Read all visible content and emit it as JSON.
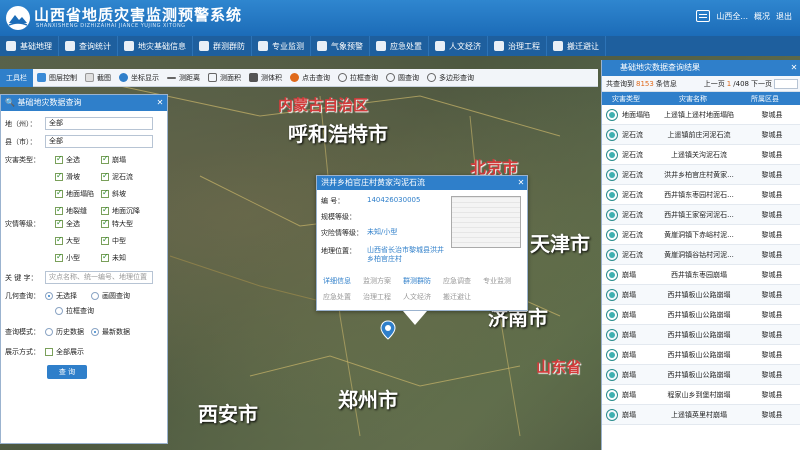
{
  "header": {
    "title": "山西省地质灾害监测预警系统",
    "subtitle": "SHANXISHENG DIZHIZAIHAI JIANCE YUJING XITONG",
    "user": "山西全...",
    "links": [
      "概况",
      "退出"
    ]
  },
  "nav": [
    {
      "label": "基础地理",
      "icon": "globe-icon"
    },
    {
      "label": "查询统计",
      "icon": "chart-icon"
    },
    {
      "label": "地灾基础信息",
      "icon": "document-icon"
    },
    {
      "label": "群测群防",
      "icon": "people-icon"
    },
    {
      "label": "专业监测",
      "icon": "monitor-icon"
    },
    {
      "label": "气象预警",
      "icon": "weather-icon"
    },
    {
      "label": "应急处置",
      "icon": "emergency-icon"
    },
    {
      "label": "人文经济",
      "icon": "people-icon"
    },
    {
      "label": "治理工程",
      "icon": "tools-icon"
    },
    {
      "label": "搬迁避让",
      "icon": "relocate-icon"
    }
  ],
  "toolbar": {
    "label": "工具栏",
    "items": [
      "图层控制",
      "截图",
      "坐标显示",
      "测距离",
      "测面积",
      "测体积",
      "点击查询",
      "拉框查询",
      "圆查询",
      "多边形查询"
    ]
  },
  "map_labels": [
    "内蒙古自治区",
    "呼和浩特市",
    "北京市",
    "天津市",
    "济南市",
    "山东省",
    "郑州市",
    "西安市"
  ],
  "left_panel": {
    "title": "基础地灾数据查询",
    "city_label": "地（州）：",
    "city_value": "全部",
    "county_label": "县（市）：",
    "county_value": "全部",
    "hazard_type_label": "灾害类型：",
    "hazard_types": [
      {
        "label": "全选",
        "checked": true
      },
      {
        "label": "崩塌",
        "checked": true
      },
      {
        "label": "滑坡",
        "checked": true
      },
      {
        "label": "泥石流",
        "checked": true
      },
      {
        "label": "地面塌陷",
        "checked": true
      },
      {
        "label": "斜坡",
        "checked": true
      },
      {
        "label": "地裂缝",
        "checked": true
      },
      {
        "label": "地面沉降",
        "checked": true
      }
    ],
    "level_label": "灾情等级：",
    "levels": [
      {
        "label": "全选",
        "checked": true
      },
      {
        "label": "特大型",
        "checked": true
      },
      {
        "label": "大型",
        "checked": true
      },
      {
        "label": "中型",
        "checked": true
      },
      {
        "label": "小型",
        "checked": true
      },
      {
        "label": "未知",
        "checked": true
      }
    ],
    "keyword_label": "关 键 字：",
    "keyword_placeholder": "灾点名称、统一编号、地理位置",
    "geo_label": "几何查询：",
    "geo_options": [
      {
        "label": "无选择",
        "checked": true
      },
      {
        "label": "画圆查询",
        "checked": false
      },
      {
        "label": "拉框查询",
        "checked": false
      }
    ],
    "mode_label": "查询模式：",
    "mode_options": [
      {
        "label": "历史数据",
        "checked": false
      },
      {
        "label": "最新数据",
        "checked": true
      }
    ],
    "display_label": "展示方式：",
    "display_option": "全部展示",
    "query_button": "查 询"
  },
  "popup": {
    "title": "洪井乡柏官庄村黄家沟泥石流",
    "fields": [
      {
        "key": "编    号：",
        "value": "140426030005"
      },
      {
        "key": "规模等级：",
        "value": ""
      },
      {
        "key": "灾险情等级：",
        "value": "未知/小型"
      },
      {
        "key": "地理位置：",
        "value": "山西省长治市黎城县洪井乡柏官庄村"
      }
    ],
    "tabs": [
      {
        "label": "详细信息",
        "active": true
      },
      {
        "label": "监测方案",
        "active": false
      },
      {
        "label": "群测群防",
        "active": true
      },
      {
        "label": "应急调查",
        "active": false
      },
      {
        "label": "专业监测",
        "active": false
      },
      {
        "label": "应急处置",
        "active": false
      },
      {
        "label": "治理工程",
        "active": false
      },
      {
        "label": "人文经济",
        "active": false
      },
      {
        "label": "搬迁避让",
        "active": false
      }
    ]
  },
  "right_panel": {
    "title": "基础地灾数据查询结果",
    "summary_prefix": "共查询到",
    "summary_count": "8153",
    "summary_suffix": "条信息",
    "pager": {
      "prev": "上一页",
      "current": "1",
      "total": "/408",
      "next": "下一页"
    },
    "columns": [
      "灾害类型",
      "灾害名称",
      "所属区县"
    ],
    "rows": [
      {
        "type": "地面塌陷",
        "name": "上遥镇上遥村地面塌陷",
        "county": "黎城县"
      },
      {
        "type": "泥石流",
        "name": "上遥镇前庄河泥石流",
        "county": "黎城县"
      },
      {
        "type": "泥石流",
        "name": "上遥镇关沟泥石流",
        "county": "黎城县"
      },
      {
        "type": "泥石流",
        "name": "洪井乡柏官庄村黄家...",
        "county": "黎城县"
      },
      {
        "type": "泥石流",
        "name": "西井镇东枣园村泥石...",
        "county": "黎城县"
      },
      {
        "type": "泥石流",
        "name": "西井镇王家窑河泥石...",
        "county": "黎城县"
      },
      {
        "type": "泥石流",
        "name": "黄崖洞镇下赤峪村泥...",
        "county": "黎城县"
      },
      {
        "type": "泥石流",
        "name": "黄崖洞镇谷钴村河泥...",
        "county": "黎城县"
      },
      {
        "type": "崩塌",
        "name": "西井镇东枣园崩塌",
        "county": "黎城县"
      },
      {
        "type": "崩塌",
        "name": "西井镇板山公路崩塌",
        "county": "黎城县"
      },
      {
        "type": "崩塌",
        "name": "西井镇板山公路崩塌",
        "county": "黎城县"
      },
      {
        "type": "崩塌",
        "name": "西井镇板山公路崩塌",
        "county": "黎城县"
      },
      {
        "type": "崩塌",
        "name": "西井镇板山公路崩塌",
        "county": "黎城县"
      },
      {
        "type": "崩塌",
        "name": "西井镇板山公路崩塌",
        "county": "黎城县"
      },
      {
        "type": "崩塌",
        "name": "程家山乡到堡村崩塌",
        "county": "黎城县"
      },
      {
        "type": "崩塌",
        "name": "上遥镇英里村崩塌",
        "county": "黎城县"
      }
    ]
  },
  "colors": {
    "header": "#1c6cb8",
    "nav": "#1e5f9e",
    "accent": "#2f7fca",
    "highlight": "#e06a1b"
  }
}
